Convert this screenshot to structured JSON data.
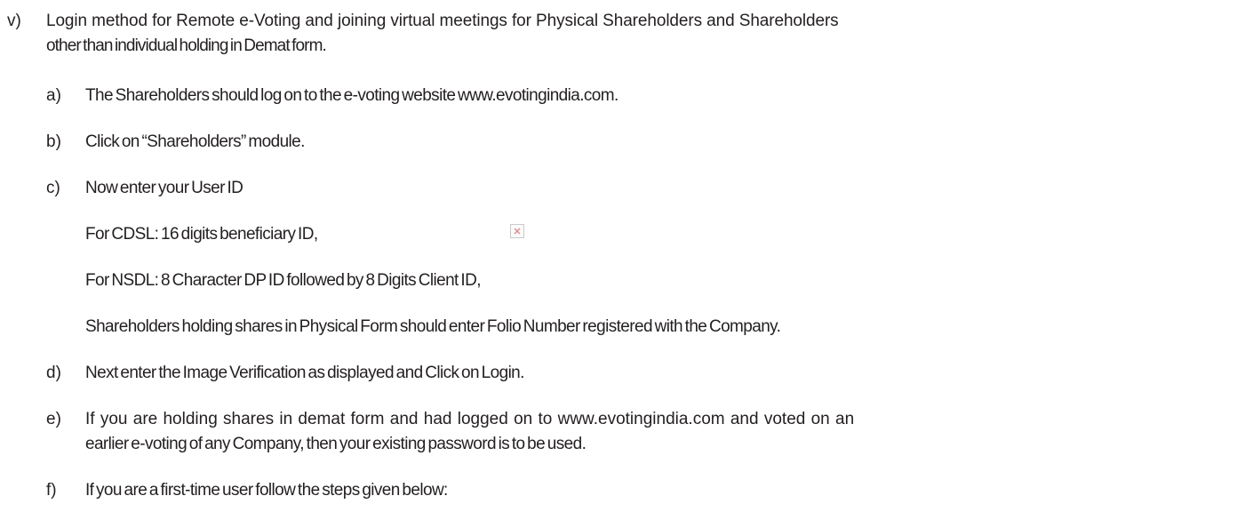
{
  "main_item": {
    "marker": "v)",
    "text_line1": "Login method for Remote e-Voting and joining virtual meetings for Physical Shareholders and Shareholders",
    "text_line2": "other than individual holding in Demat form."
  },
  "sub_items": [
    {
      "marker": "a)",
      "text": "The Shareholders should log on to the e-voting website www.evotingindia.com."
    },
    {
      "marker": "b)",
      "text": "Click on “Shareholders” module."
    },
    {
      "marker": "c)",
      "text": "Now enter your User ID",
      "details": [
        "For CDSL: 16 digits beneficiary ID,",
        "For NSDL: 8 Character DP ID followed by 8 Digits Client ID,",
        "Shareholders holding shares in Physical Form should enter Folio Number registered with the Company."
      ]
    },
    {
      "marker": "d)",
      "text": "Next enter the Image Verification as displayed and Click on Login."
    },
    {
      "marker": "e)",
      "text_line1": "If you are holding shares in demat form and had logged on to www.evotingindia.com and voted on an",
      "text_line2": "earlier e-voting of any Company, then your existing password is to be used."
    },
    {
      "marker": "f)",
      "text": "If you are a first-time user follow the steps given below:"
    }
  ],
  "icons": {
    "broken_image": "broken-image-icon"
  }
}
